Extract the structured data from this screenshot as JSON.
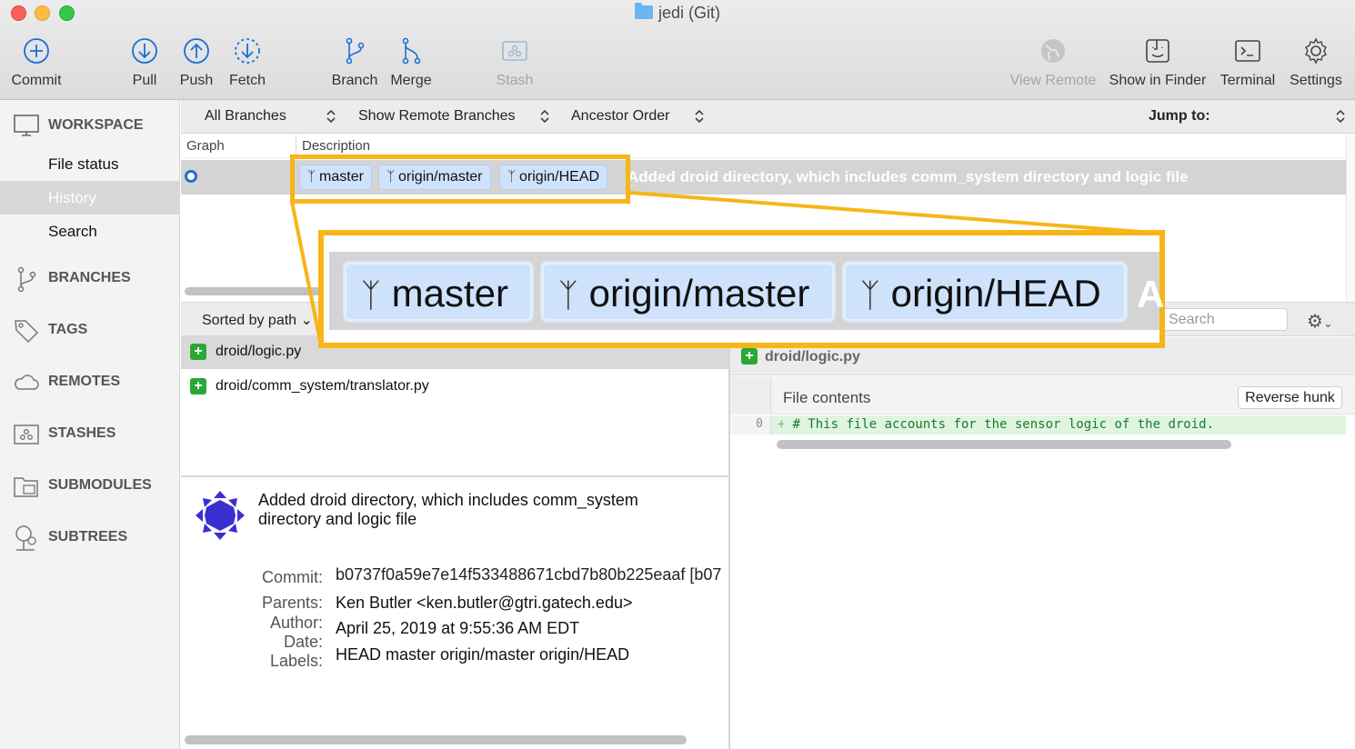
{
  "window": {
    "title": "jedi (Git)"
  },
  "toolbar": {
    "commit": "Commit",
    "pull": "Pull",
    "push": "Push",
    "fetch": "Fetch",
    "branch": "Branch",
    "merge": "Merge",
    "stash": "Stash",
    "view_remote": "View Remote",
    "show_in_finder": "Show in Finder",
    "terminal": "Terminal",
    "settings": "Settings"
  },
  "sidebar": {
    "workspace": "WORKSPACE",
    "items": [
      "File status",
      "History",
      "Search"
    ],
    "active_item": "History",
    "sections": [
      "BRANCHES",
      "TAGS",
      "REMOTES",
      "STASHES",
      "SUBMODULES",
      "SUBTREES"
    ]
  },
  "filterbar": {
    "branches": "All Branches",
    "remote": "Show Remote Branches",
    "order": "Ancestor Order",
    "jump": "Jump to:"
  },
  "log": {
    "columns": [
      "Graph",
      "Description"
    ],
    "row": {
      "tags": [
        "master",
        "origin/master",
        "origin/HEAD"
      ],
      "message": "Added droid directory, which includes comm_system directory and logic file"
    }
  },
  "files": {
    "sort_label": "Sorted by path",
    "list": [
      "droid/logic.py",
      "droid/comm_system/translator.py"
    ],
    "selected": "droid/logic.py"
  },
  "commit_details": {
    "message": "Added droid directory, which includes comm_system directory and logic file",
    "labels": {
      "commit": "Commit:",
      "parents": "Parents:",
      "author": "Author:",
      "date": "Date:",
      "tags": "Labels:"
    },
    "commit": "b0737f0a59e7e14f533488671cbd7b80b225eaaf [b07",
    "author": "Ken Butler <ken.butler@gtri.gatech.edu>",
    "date": "April 25, 2019 at 9:55:36 AM EDT",
    "labels_value": "HEAD master origin/master origin/HEAD"
  },
  "diff": {
    "search_placeholder": "Search",
    "file": "droid/logic.py",
    "hunk_title": "File contents",
    "reverse_hunk": "Reverse hunk",
    "line_number": "0",
    "line_prefix": "+",
    "line": "# This file accounts for the sensor logic of the droid."
  },
  "zoom": {
    "tags": [
      "master",
      "origin/master",
      "origin/HEAD"
    ],
    "ghost": "A"
  },
  "colors": {
    "highlight": "#f7b518",
    "tag_bg": "#cfe2fb",
    "accent": "#1c6fd6",
    "added": "#2aa836"
  }
}
